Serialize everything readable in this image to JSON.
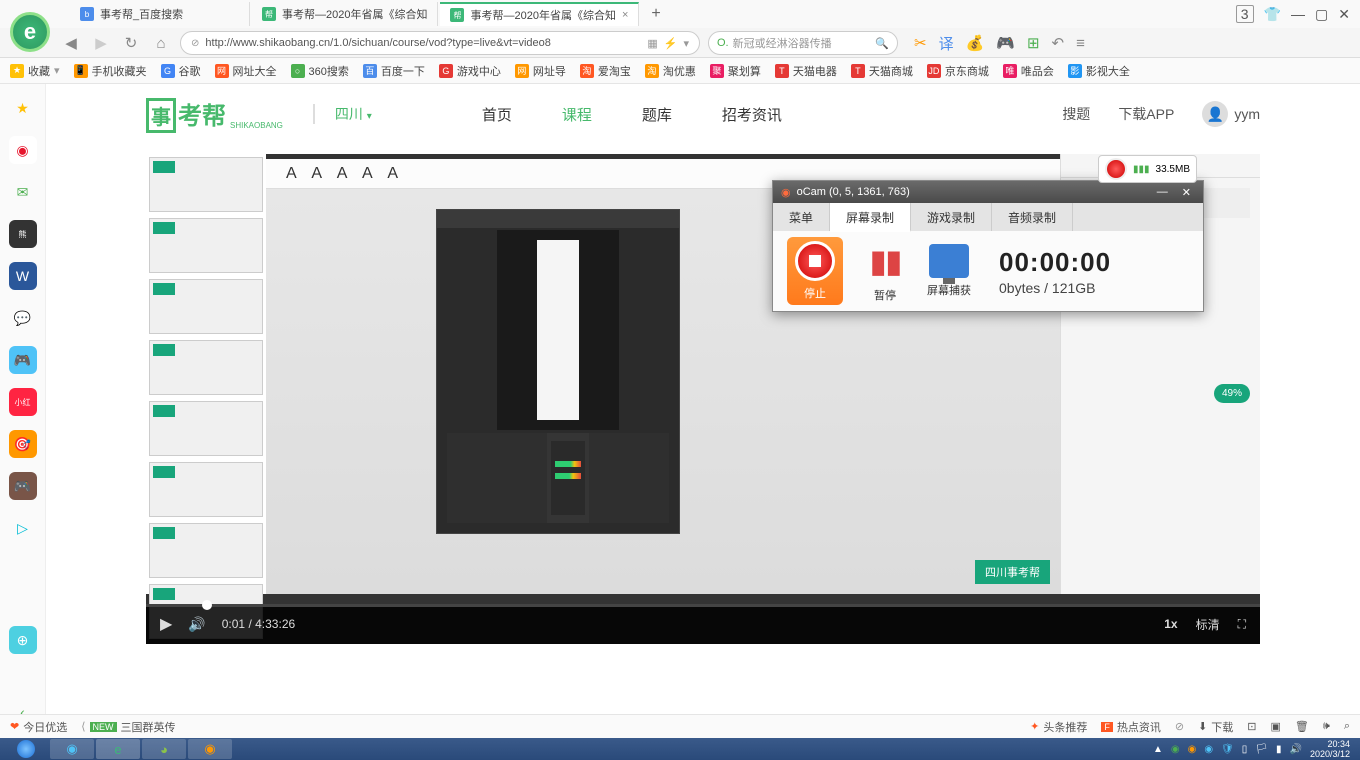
{
  "browser": {
    "tabs": [
      {
        "label": "事考帮_百度搜索",
        "icon": "baidu"
      },
      {
        "label": "事考帮—2020年省属《综合知",
        "icon": "skb"
      },
      {
        "label": "事考帮—2020年省属《综合知",
        "icon": "skb",
        "active": true
      }
    ],
    "window_count": "3",
    "url": "http://www.shikaobang.cn/1.0/sichuan/course/vod?type=live&vt=video8",
    "search_placeholder": "新冠或经淋浴器传播"
  },
  "bookmarks": {
    "fav": "收藏",
    "items": [
      {
        "label": "手机收藏夹",
        "color": "#ff9800"
      },
      {
        "label": "谷歌",
        "color": "#4285f4"
      },
      {
        "label": "网址大全",
        "color": "#ff5722"
      },
      {
        "label": "360搜索",
        "color": "#4caf50"
      },
      {
        "label": "百度一下",
        "color": "#4d8deb"
      },
      {
        "label": "游戏中心",
        "color": "#e53935"
      },
      {
        "label": "网址导",
        "color": "#ff9800"
      },
      {
        "label": "爱淘宝",
        "color": "#ff5722"
      },
      {
        "label": "淘优惠",
        "color": "#ff9800"
      },
      {
        "label": "聚划算",
        "color": "#e91e63"
      },
      {
        "label": "天猫电器",
        "color": "#e53935"
      },
      {
        "label": "天猫商城",
        "color": "#e53935"
      },
      {
        "label": "京东商城",
        "color": "#e53935"
      },
      {
        "label": "唯品会",
        "color": "#e91e63"
      },
      {
        "label": "影视大全",
        "color": "#2196f3"
      }
    ]
  },
  "site": {
    "logo": "考帮",
    "logo_sub": "SHIKAOBANG",
    "location": "四川",
    "nav": {
      "home": "首页",
      "course": "课程",
      "tiku": "题库",
      "news": "招考资讯"
    },
    "right": {
      "souti": "搜题",
      "app": "下载APP",
      "user": "yym"
    }
  },
  "video": {
    "current": "0:01",
    "total": "4:33:26",
    "speed": "1x",
    "quality": "标清",
    "watermark": "四川事考帮",
    "chat_badge": "49"
  },
  "ocam": {
    "badge_size": "33.5MB",
    "title_icon": "●",
    "title": "oCam (0, 5, 1361, 763)",
    "tabs": {
      "menu": "菜单",
      "screen": "屏幕录制",
      "game": "游戏录制",
      "audio": "音频录制"
    },
    "btn": {
      "stop": "停止",
      "pause": "暂停",
      "capture": "屏幕捕获"
    },
    "time": "00:00:00",
    "size": "0bytes / 121GB"
  },
  "status": {
    "left1": "今日优选",
    "left2": "三国群英传",
    "right": {
      "toutiao": "头条推荐",
      "hot": "热点资讯",
      "dl": "下载"
    }
  },
  "taskbar": {
    "time": "20:34",
    "date": "2020/3/12"
  }
}
